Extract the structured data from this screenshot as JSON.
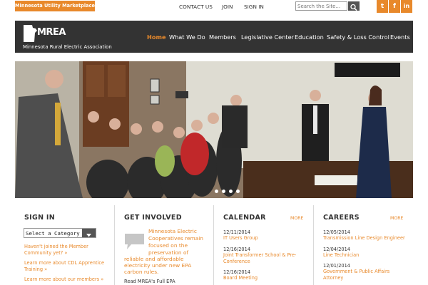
{
  "topbar": {
    "marketplace_label": "Minnesota Utility Marketplace »",
    "links": [
      "CONTACT US",
      "JOIN",
      "SIGN IN"
    ],
    "search_placeholder": "Search the Site...",
    "social": [
      {
        "icon": "twitter-icon",
        "glyph": "t"
      },
      {
        "icon": "facebook-icon",
        "glyph": "f"
      },
      {
        "icon": "linkedin-icon",
        "glyph": "in"
      }
    ]
  },
  "header": {
    "logo_text": "MREA",
    "logo_subtitle": "Minnesota Rural Electric Association",
    "nav": [
      "Home",
      "What We Do",
      "Members",
      "Legislative Center",
      "Education",
      "Safety & Loss Control",
      "Events"
    ],
    "active_nav": "Home"
  },
  "carousel": {
    "slide_count": 4,
    "active_slide": 1
  },
  "signin": {
    "title": "SIGN IN",
    "select_value": "Select a Category",
    "links": [
      "Haven't joined the Member Community yet? »",
      "Learn more about CDL Apprentice Training »",
      "Learn more about our members »"
    ]
  },
  "get_involved": {
    "title": "GET INVOLVED",
    "text_lines": [
      "Minnesota Electric",
      "Cooperatives remain",
      "focused on the",
      "preservation of",
      "reliable and affordable",
      "electricity under new EPA",
      "carbon rules."
    ],
    "link": "Read MREA's Full EPA"
  },
  "calendar": {
    "title": "CALENDAR",
    "more_label": "MORE",
    "events": [
      {
        "date": "12/11/2014",
        "title": "IT Users Group"
      },
      {
        "date": "12/16/2014",
        "title": "Joint Transformer School & Pre-Conference"
      },
      {
        "date": "12/16/2014",
        "title": "Board Meeting"
      }
    ]
  },
  "careers": {
    "title": "CAREERS",
    "more_label": "MORE",
    "jobs": [
      {
        "date": "12/05/2014",
        "title": "Transmission Line Design Engineer"
      },
      {
        "date": "12/04/2014",
        "title": "Line Technician"
      },
      {
        "date": "12/01/2014",
        "title": "Government & Public Affairs Attorney"
      }
    ]
  },
  "colors": {
    "accent": "#e8892b",
    "header_bg": "#333333",
    "text": "#333333"
  }
}
